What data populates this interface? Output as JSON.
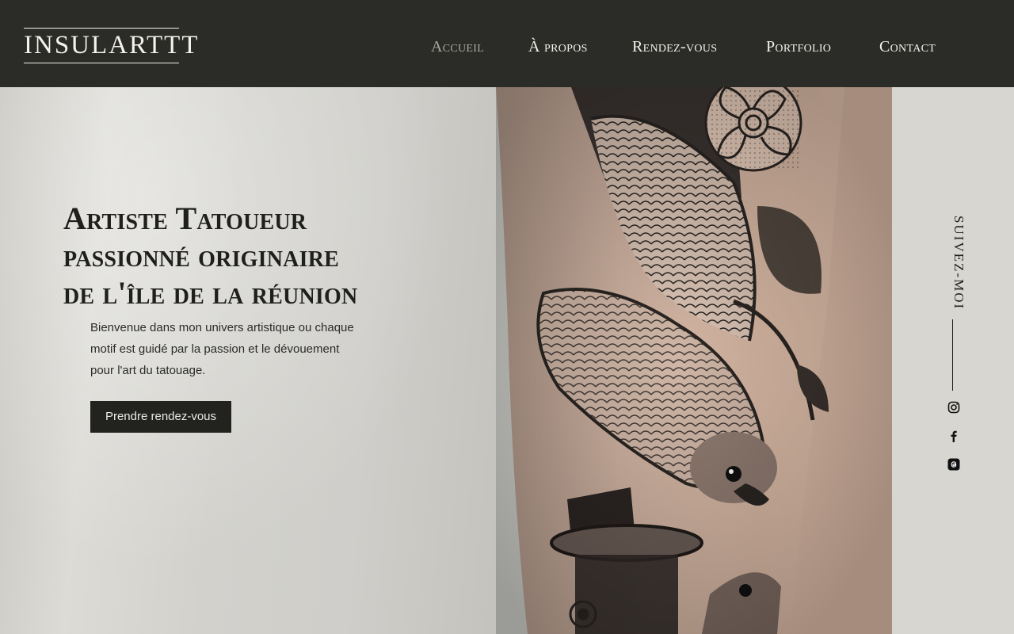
{
  "header": {
    "logo": "INSULARTTT",
    "nav": [
      {
        "label": "Accueil",
        "active": true
      },
      {
        "label": "À propos",
        "active": false
      },
      {
        "label": "Rendez-vous",
        "active": false
      },
      {
        "label": "Portfolio",
        "active": false
      },
      {
        "label": "Contact",
        "active": false
      }
    ]
  },
  "hero": {
    "title_line1": "Artiste Tatoueur",
    "title_line2": "passionné originaire",
    "title_line3": "de l'île de la réunion",
    "description": "Bienvenue dans mon univers artistique ou chaque motif est guidé par la passion et le dévouement pour l'art du tatouage.",
    "cta_label": "Prendre rendez-vous"
  },
  "sidebar": {
    "follow_label": "Suivez-moi",
    "socials": [
      {
        "name": "instagram-icon"
      },
      {
        "name": "facebook-icon"
      },
      {
        "name": "threads-icon"
      }
    ]
  },
  "colors": {
    "header_bg": "#2b2b27",
    "nav_active": "#a9a79f",
    "cta_bg": "#22221f"
  }
}
